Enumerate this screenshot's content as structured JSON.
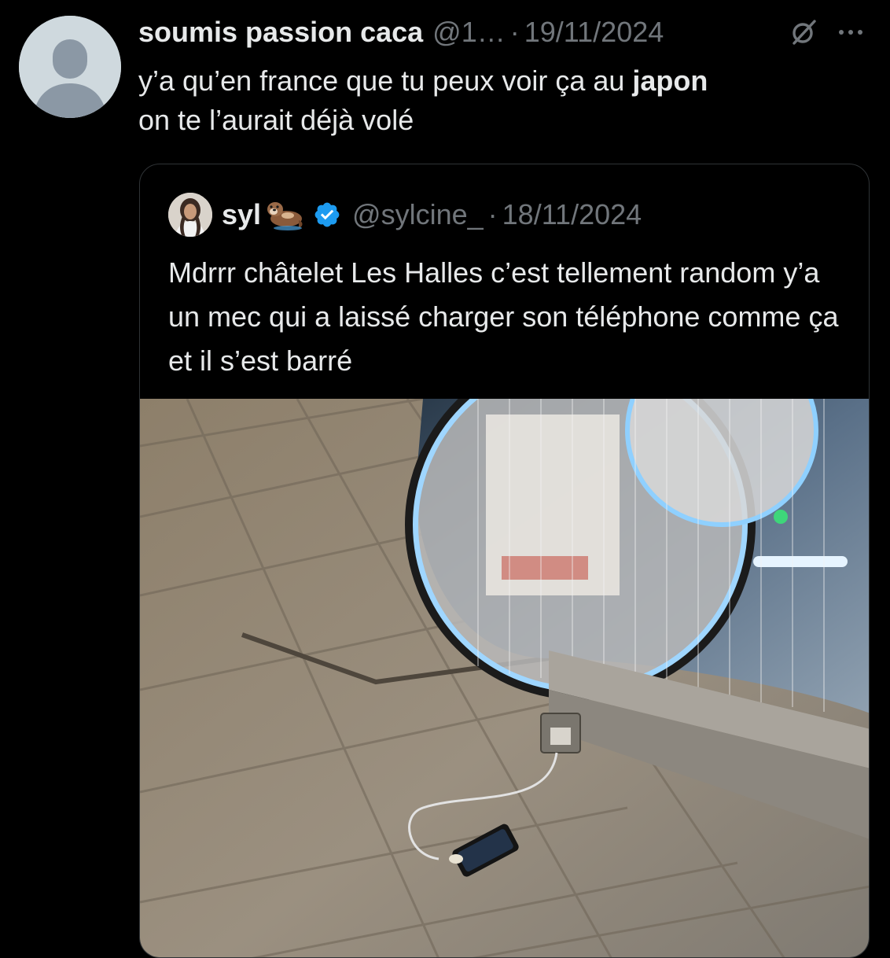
{
  "tweet": {
    "display_name": "soumis passion caca",
    "handle": "@1…",
    "separator": "·",
    "date": "19/11/2024",
    "text_part1": "y’a qu’en france que tu peux voir ça au ",
    "text_bold": "japon",
    "text_part2": " on te l’aurait déjà volé",
    "icons": {
      "avatar": "default-avatar-icon",
      "grok": "grok-icon",
      "more": "more-options-icon"
    }
  },
  "quote": {
    "display_name": "syl",
    "emoji_icon": "otter-emoji-icon",
    "verified_icon": "verified-badge-icon",
    "handle": "@sylcine_",
    "separator": "·",
    "date": "18/11/2024",
    "text": "Mdrrr châtelet Les Halles c’est tellement random y’a un mec qui a laissé charger son téléphone comme ça et il s’est barré"
  },
  "colors": {
    "background": "#000000",
    "text_primary": "#e7e9ea",
    "text_secondary": "#71767b",
    "border": "#2f3336",
    "verified": "#1d9bf0"
  }
}
